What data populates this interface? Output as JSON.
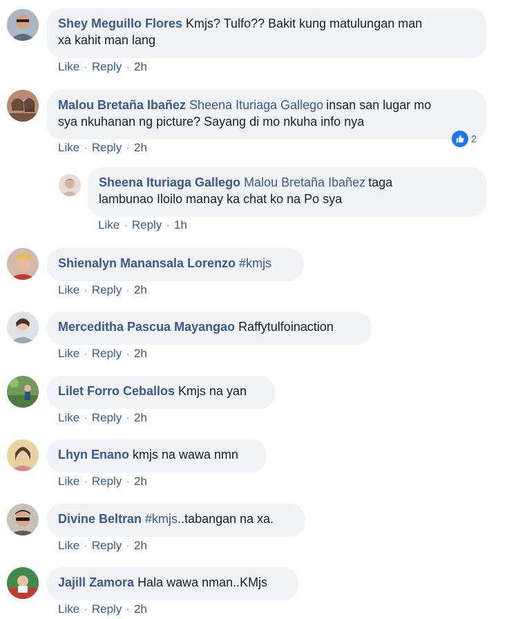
{
  "actions": {
    "like": "Like",
    "reply": "Reply",
    "separator": "·"
  },
  "colors": {
    "link": "#385898",
    "bubble": "#f0f2f5",
    "reaction_like": "#1877f2"
  },
  "comments": [
    {
      "author": "Shey Meguillo Flores",
      "line1": "Kmjs? Tulfo?? Bakit kung matulungan man",
      "line2": "xa kahit man lang",
      "time": "2h"
    },
    {
      "author": "Malou Bretaña Ibañez",
      "mention": "Sheena Ituriaga Gallego",
      "line1": "insan san lugar mo",
      "line2": "sya nkuhanan ng picture? Sayang di mo nkuha info nya",
      "time": "2h",
      "reaction_count": "2",
      "reaction_icon": "like-thumb-icon",
      "reply": {
        "author": "Sheena Ituriaga Gallego",
        "mention": "Malou Bretaña Ibañez",
        "line1": "taga",
        "line2": "lambunao Iloilo manay ka chat ko na Po sya",
        "time": "1h"
      }
    },
    {
      "author": "Shienalyn Manansala Lorenzo",
      "hashtag": "#kmjs",
      "time": "2h"
    },
    {
      "author": "Merceditha Pascua Mayangao",
      "text": "Raffytulfoinaction",
      "time": "2h"
    },
    {
      "author": "Lilet Forro Ceballos",
      "text": "Kmjs na yan",
      "time": "2h"
    },
    {
      "author": "Lhyn Enano",
      "text": "kmjs na wawa nmn",
      "time": "2h"
    },
    {
      "author": "Divine Beltran",
      "hashtag": "#kmjs",
      "text": "..tabangan na xa.",
      "time": "2h"
    },
    {
      "author": "Jajill Zamora",
      "text": "Hala wawa nman..KMjs",
      "time": "2h"
    }
  ]
}
